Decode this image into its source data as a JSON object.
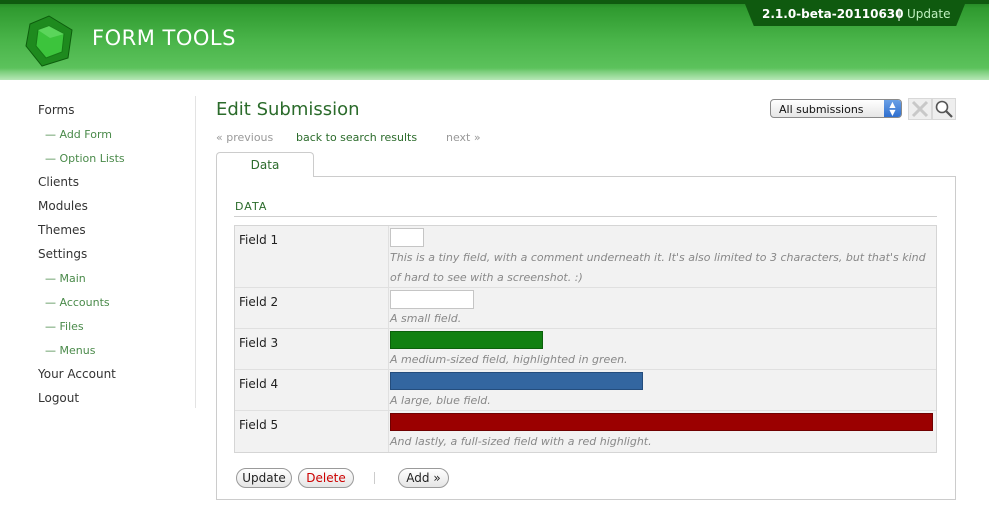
{
  "header": {
    "app_title": "FORM TOOLS",
    "version": "2.1.0-beta-20110630",
    "separator": "|",
    "update_label": "Update",
    "colors": {
      "brand_green": "#2f9a2f",
      "dark_green": "#0f5a0f"
    }
  },
  "sidebar": {
    "items": [
      {
        "label": "Forms",
        "level": 0
      },
      {
        "label": "— Add Form",
        "level": 1
      },
      {
        "label": "— Option Lists",
        "level": 1
      },
      {
        "label": "Clients",
        "level": 0
      },
      {
        "label": "Modules",
        "level": 0
      },
      {
        "label": "Themes",
        "level": 0
      },
      {
        "label": "Settings",
        "level": 0
      },
      {
        "label": "— Main",
        "level": 1
      },
      {
        "label": "— Accounts",
        "level": 1
      },
      {
        "label": "— Files",
        "level": 1
      },
      {
        "label": "— Menus",
        "level": 1
      },
      {
        "label": "Your Account",
        "level": 0
      },
      {
        "label": "Logout",
        "level": 0
      }
    ]
  },
  "main": {
    "title": "Edit Submission",
    "nav": {
      "previous": "« previous",
      "back": "back to search results",
      "next": "next »"
    },
    "view_select": {
      "selected": "All submissions"
    },
    "icons": [
      "clear-filter-icon",
      "search-icon"
    ],
    "tabs": [
      {
        "label": "Data",
        "active": true
      }
    ],
    "section_title": "DATA",
    "fields": [
      {
        "label": "Field 1",
        "comment": "This is a tiny field, with a comment underneath it. It's also limited to 3 characters, but that's kind of hard to see with a screenshot. :)",
        "size": "tiny",
        "highlight": "#ffffff"
      },
      {
        "label": "Field 2",
        "comment": "A small field.",
        "size": "small",
        "highlight": "#ffffff"
      },
      {
        "label": "Field 3",
        "comment": "A medium-sized field, highlighted in green.",
        "size": "medium",
        "highlight": "#118011"
      },
      {
        "label": "Field 4",
        "comment": "A large, blue field.",
        "size": "large",
        "highlight": "#3366a0"
      },
      {
        "label": "Field 5",
        "comment": "And lastly, a full-sized field with a red highlight.",
        "size": "full",
        "highlight": "#9b0000"
      }
    ],
    "buttons": {
      "update": "Update",
      "delete": "Delete",
      "add": "Add »"
    }
  }
}
